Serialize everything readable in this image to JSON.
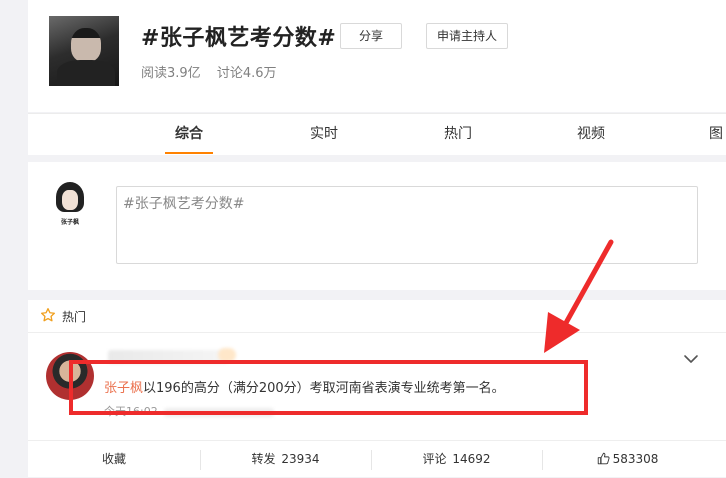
{
  "topic": {
    "title": "#张子枫艺考分数#",
    "share_label": "分享",
    "host_label": "申请主持人",
    "reads": "阅读3.9亿",
    "discussions": "讨论4.6万"
  },
  "tabs": [
    "综合",
    "实时",
    "热门",
    "视频",
    "图"
  ],
  "active_tab": "综合",
  "composer": {
    "avatar_tag": "张子枫",
    "input_text": "#张子枫艺考分数#"
  },
  "feed": {
    "hot_label": "热门",
    "post": {
      "topic_name": "张子枫",
      "text_rest": "以196的高分（满分200分）考取河南省表演专业统考第一名。",
      "time": "今天16:02"
    },
    "actions": {
      "favorite": "收藏",
      "repost_label": "转发",
      "repost_count": "23934",
      "comment_label": "评论",
      "comment_count": "14692",
      "like_count": "583308"
    }
  },
  "colors": {
    "accent": "#ff8200",
    "topic_link": "#eb7350",
    "annotation_red": "#ee2b2b"
  }
}
